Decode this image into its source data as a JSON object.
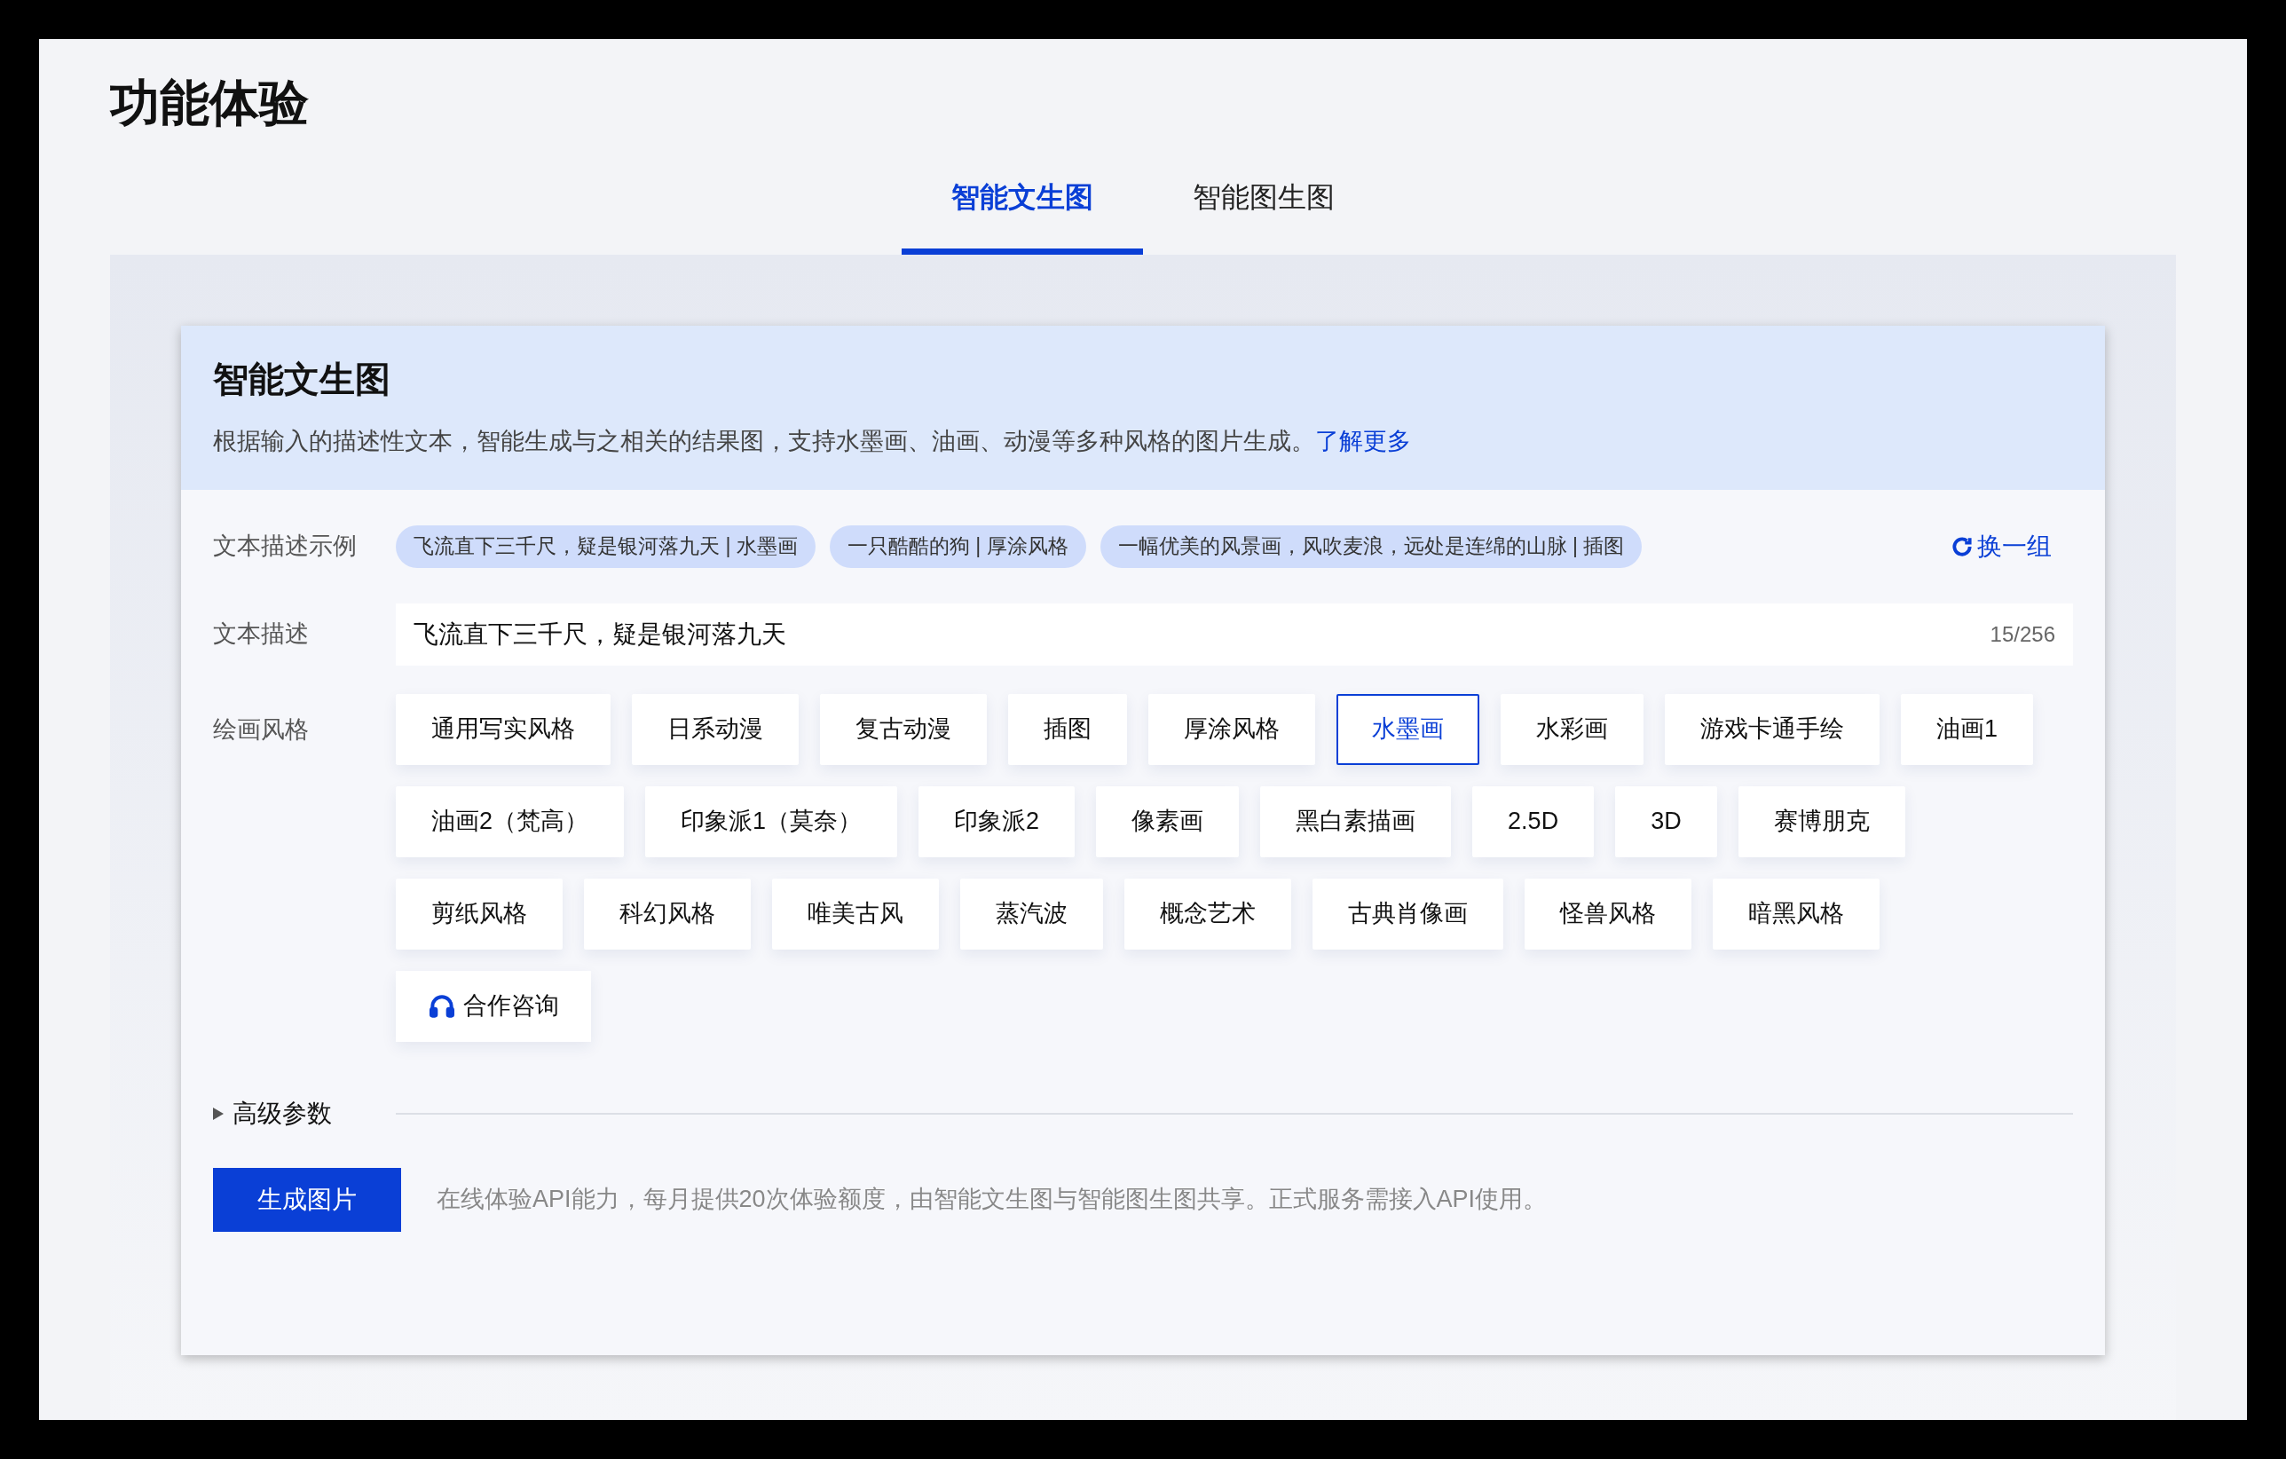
{
  "page_title": "功能体验",
  "tabs": [
    {
      "label": "智能文生图",
      "selected": true
    },
    {
      "label": "智能图生图",
      "selected": false
    }
  ],
  "card": {
    "title": "智能文生图",
    "description": "根据输入的描述性文本，智能生成与之相关的结果图，支持水墨画、油画、动漫等多种风格的图片生成。",
    "learn_more": "了解更多"
  },
  "examples": {
    "label": "文本描述示例",
    "chips": [
      "飞流直下三千尺，疑是银河落九天 | 水墨画",
      "一只酷酷的狗 | 厚涂风格",
      "一幅优美的风景画，风吹麦浪，远处是连绵的山脉 | 插图"
    ],
    "refresh": "换一组"
  },
  "description_field": {
    "label": "文本描述",
    "value": "飞流直下三千尺，疑是银河落九天",
    "counter": "15/256"
  },
  "styles": {
    "label": "绘画风格",
    "items": [
      {
        "label": "通用写实风格",
        "selected": false
      },
      {
        "label": "日系动漫",
        "selected": false
      },
      {
        "label": "复古动漫",
        "selected": false
      },
      {
        "label": "插图",
        "selected": false
      },
      {
        "label": "厚涂风格",
        "selected": false
      },
      {
        "label": "水墨画",
        "selected": true
      },
      {
        "label": "水彩画",
        "selected": false
      },
      {
        "label": "游戏卡通手绘",
        "selected": false
      },
      {
        "label": "油画1",
        "selected": false
      },
      {
        "label": "油画2（梵高）",
        "selected": false
      },
      {
        "label": "印象派1（莫奈）",
        "selected": false
      },
      {
        "label": "印象派2",
        "selected": false
      },
      {
        "label": "像素画",
        "selected": false
      },
      {
        "label": "黑白素描画",
        "selected": false
      },
      {
        "label": "2.5D",
        "selected": false
      },
      {
        "label": "3D",
        "selected": false
      },
      {
        "label": "赛博朋克",
        "selected": false
      },
      {
        "label": "剪纸风格",
        "selected": false
      },
      {
        "label": "科幻风格",
        "selected": false
      },
      {
        "label": "唯美古风",
        "selected": false
      },
      {
        "label": "蒸汽波",
        "selected": false
      },
      {
        "label": "概念艺术",
        "selected": false
      },
      {
        "label": "古典肖像画",
        "selected": false
      },
      {
        "label": "怪兽风格",
        "selected": false
      },
      {
        "label": "暗黑风格",
        "selected": false
      }
    ],
    "contact": "合作咨询"
  },
  "advanced": {
    "label": "高级参数",
    "expanded": false
  },
  "generate_button": "生成图片",
  "note": "在线体验API能力，每月提供20次体验额度，由智能文生图与智能图生图共享。正式服务需接入API使用。"
}
